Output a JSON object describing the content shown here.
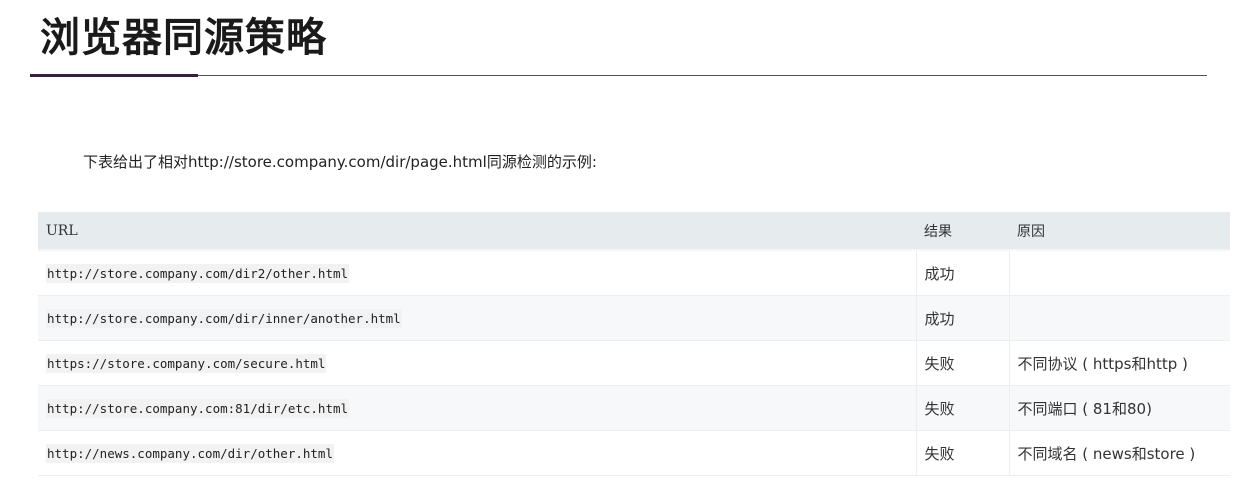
{
  "slide": {
    "title": "浏览器同源策略",
    "intro": "下表给出了相对http://store.company.com/dir/page.html同源检测的示例:"
  },
  "table": {
    "headers": {
      "url": "URL",
      "result": "结果",
      "reason": "原因"
    },
    "rows": [
      {
        "url": "http://store.company.com/dir2/other.html",
        "result": "成功",
        "reason": ""
      },
      {
        "url": "http://store.company.com/dir/inner/another.html",
        "result": "成功",
        "reason": ""
      },
      {
        "url": "https://store.company.com/secure.html",
        "result": "失败",
        "reason": "不同协议 ( https和http )"
      },
      {
        "url": "http://store.company.com:81/dir/etc.html",
        "result": "失败",
        "reason": "不同端口 ( 81和80)"
      },
      {
        "url": "http://news.company.com/dir/other.html",
        "result": "失败",
        "reason": "不同域名 ( news和store )"
      }
    ]
  },
  "colors": {
    "accent": "#3b1f3f",
    "header_bg": "#e6ebee",
    "stripe_bg": "#f6f8f9"
  }
}
